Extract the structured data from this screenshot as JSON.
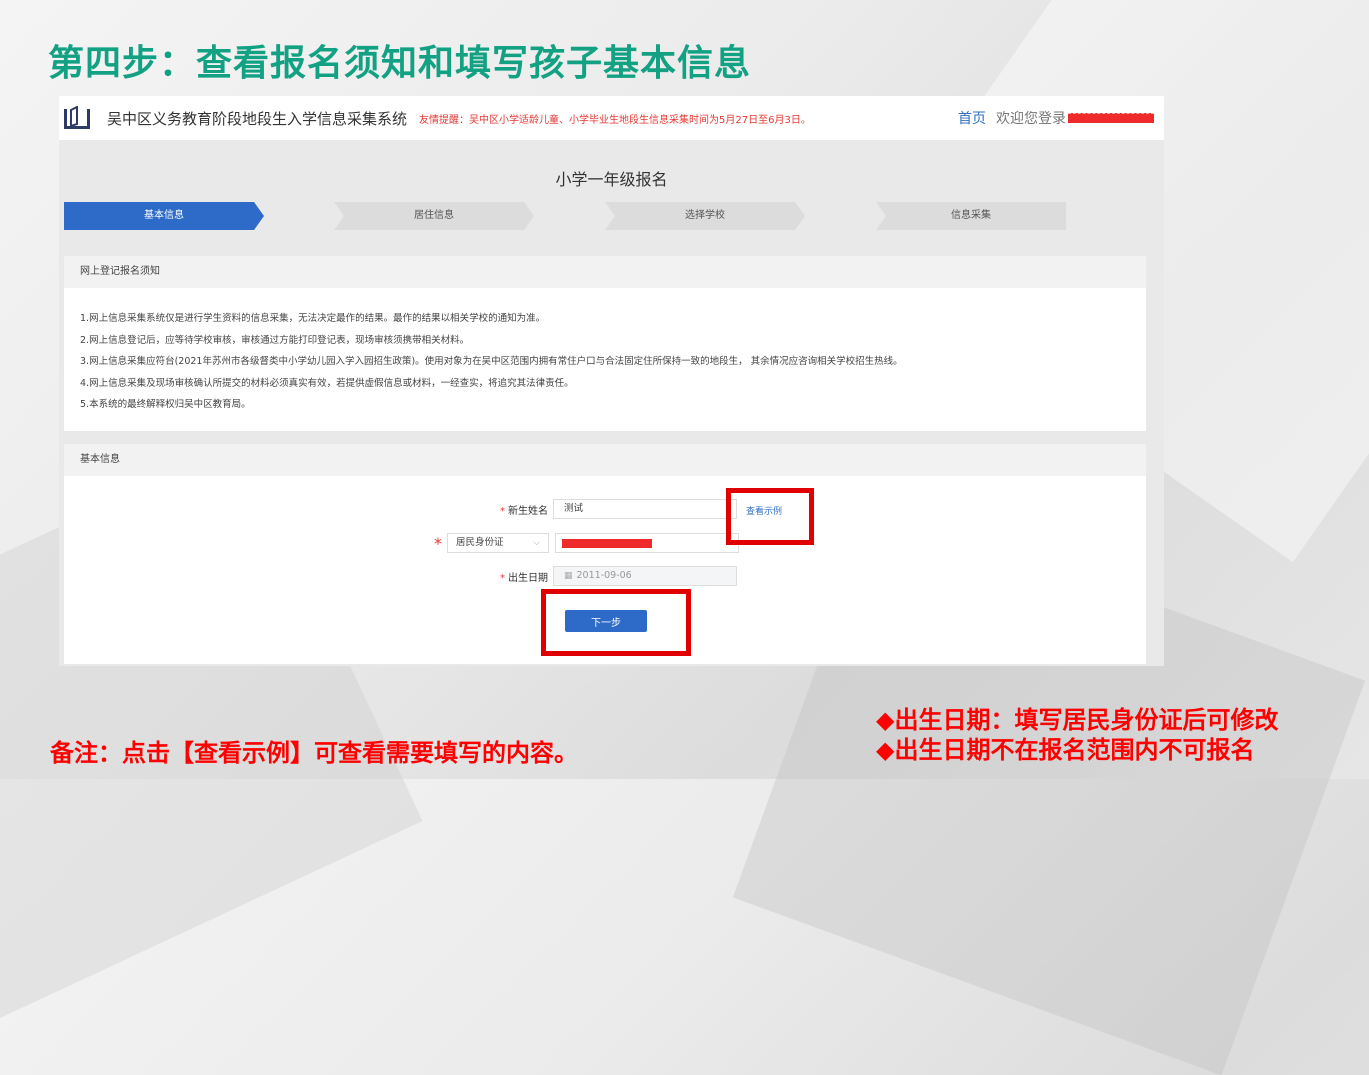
{
  "slide": {
    "title": "第四步：查看报名须知和填写孩子基本信息",
    "remark": "备注：点击【查看示例】可查看需要填写的内容。",
    "warnings": [
      "◆出生日期：填写居民身份证后可修改",
      "◆出生日期不在报名范围内不可报名"
    ],
    "accent_color": "#12a183",
    "warning_color": "#ff0000"
  },
  "header": {
    "system_name": "吴中区义务教育阶段地段生入学信息采集系统",
    "notice": "友情提醒：吴中区小学适龄儿童、小学毕业生地段生信息采集时间为5月27日至6月3日。",
    "home_link": "首页",
    "welcome": "欢迎您登录"
  },
  "page": {
    "heading": "小学一年级报名",
    "steps": [
      "基本信息",
      "居住信息",
      "选择学校",
      "信息采集"
    ],
    "active_step": 0
  },
  "notice_card": {
    "title": "网上登记报名须知",
    "items": [
      "1.网上信息采集系统仅是进行学生资料的信息采集，无法决定最作的结果。最作的结果以相关学校的通知为准。",
      "2.网上信息登记后，应等待学校审核，审核通过方能打印登记表，现场审核须携带相关材料。",
      "3.网上信息采集应符台(2021年苏州市各级督类中小学幼儿园入学入园招生政策)。使用对象为在吴中区范围内拥有常住户口与合法固定住所保持一致的地段生， 其余情况应咨询相关学校招生热线。",
      "4.网上信息采集及现场审核确认所提交的材料必须真实有效，若提供虚假信息或材料，一经查实，将追究其法律责任。",
      "5.本系统的最终解释权归吴中区教育局。"
    ]
  },
  "form_card": {
    "title": "基本信息",
    "name_label": "新生姓名",
    "name_value": "测试",
    "example_link": "查看示例",
    "id_type": "居民身份证",
    "birth_label": "出生日期",
    "birth_value": "2011-09-06",
    "next_button": "下一步",
    "required_mark": "*"
  }
}
